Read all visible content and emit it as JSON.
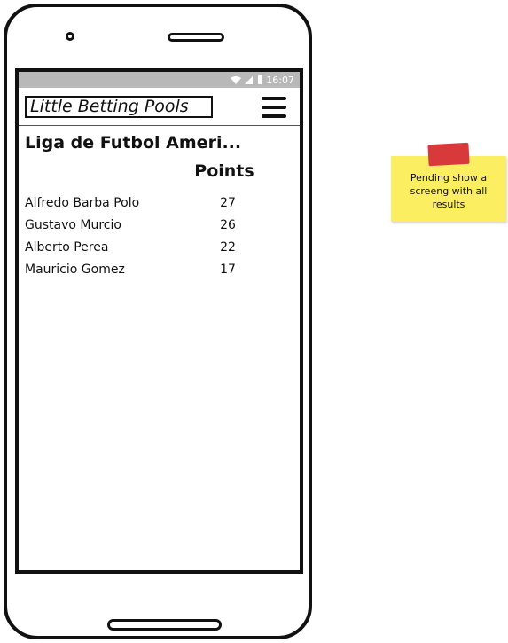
{
  "status_bar": {
    "wifi_icon": "wifi-icon",
    "signal_icon": "signal-icon",
    "battery_icon": "battery-icon",
    "time": "16:07"
  },
  "header": {
    "title": "Little Betting Pools",
    "menu_icon": "hamburger-menu-icon"
  },
  "league": {
    "title": "Liga de Futbol Ameri...",
    "points_header": "Points",
    "standings": [
      {
        "name": "Alfredo Barba Polo",
        "points": "27"
      },
      {
        "name": "Gustavo Murcio",
        "points": "26"
      },
      {
        "name": "Alberto Perea",
        "points": "22"
      },
      {
        "name": "Mauricio Gomez",
        "points": "17"
      }
    ]
  },
  "note": {
    "text": "Pending show a screeng with all results",
    "colors": {
      "paper": "#fbee60",
      "tape": "#d8393a"
    }
  }
}
